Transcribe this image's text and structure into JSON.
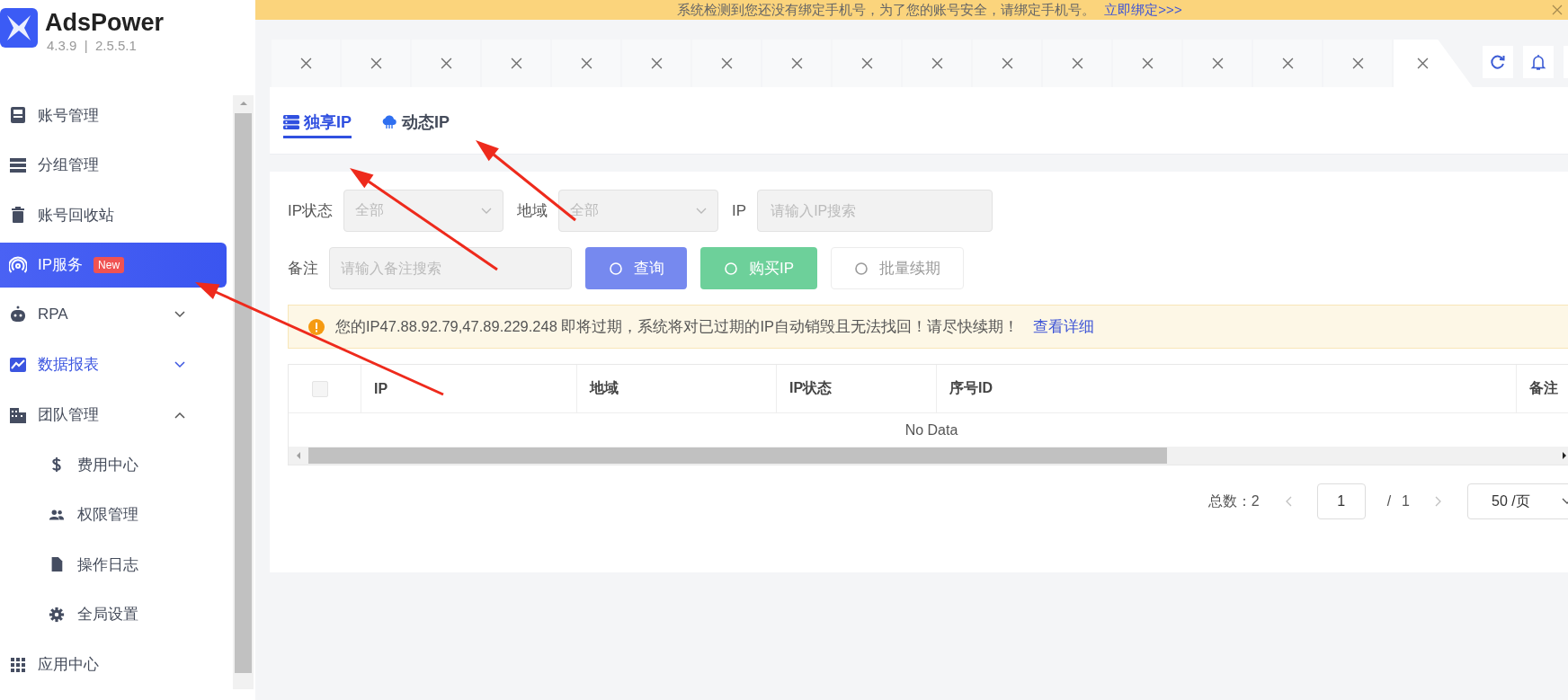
{
  "app": {
    "name": "AdsPower",
    "version": "4.3.9  |  2.5.5.1"
  },
  "sidebar": {
    "items": [
      {
        "label": "账号管理",
        "kind": "link",
        "selected": false,
        "highlighted": false
      },
      {
        "label": "分组管理",
        "kind": "link",
        "selected": false,
        "highlighted": false
      },
      {
        "label": "账号回收站",
        "kind": "link",
        "selected": false,
        "highlighted": false
      },
      {
        "label": "IP服务",
        "kind": "link",
        "selected": true,
        "highlighted": false,
        "badge": "New"
      },
      {
        "label": "RPA",
        "kind": "group",
        "selected": false,
        "highlighted": false,
        "expanded": false
      },
      {
        "label": "数据报表",
        "kind": "group",
        "selected": false,
        "highlighted": true,
        "expanded": false
      },
      {
        "label": "团队管理",
        "kind": "group",
        "selected": false,
        "highlighted": false,
        "expanded": true,
        "children": [
          {
            "label": "费用中心",
            "selected": false
          },
          {
            "label": "权限管理",
            "selected": false
          },
          {
            "label": "操作日志",
            "selected": false
          },
          {
            "label": "全局设置",
            "selected": false
          }
        ]
      },
      {
        "label": "应用中心",
        "kind": "link",
        "selected": false,
        "highlighted": false
      }
    ]
  },
  "notice": {
    "text": "系统检测到您还没有绑定手机号，为了您的账号安全，请绑定手机号。",
    "link": "立即绑定>>>"
  },
  "tabs": [
    {
      "selected": false
    },
    {
      "selected": false
    },
    {
      "selected": false
    },
    {
      "selected": false
    },
    {
      "selected": false
    },
    {
      "selected": false
    },
    {
      "selected": false
    },
    {
      "selected": false
    },
    {
      "selected": false
    },
    {
      "selected": false
    },
    {
      "selected": false
    },
    {
      "selected": false
    },
    {
      "selected": false
    },
    {
      "selected": false
    },
    {
      "selected": false
    },
    {
      "selected": false
    },
    {
      "selected": true
    }
  ],
  "ip_tabs": [
    {
      "label": "独享IP",
      "selected": true
    },
    {
      "label": "动态IP",
      "selected": false
    }
  ],
  "filter_rows": [
    {
      "fields": [
        {
          "label": "IP状态",
          "kind": "select",
          "placeholder": "全部"
        },
        {
          "label": "地域",
          "kind": "select",
          "placeholder": "全部"
        },
        {
          "label": "IP",
          "kind": "input",
          "placeholder": "请输入IP搜索"
        }
      ]
    },
    {
      "fields": [
        {
          "label": "备注",
          "kind": "input",
          "placeholder": "请输入备注搜索"
        }
      ],
      "buttons": [
        {
          "label": "查询",
          "kind": "primary",
          "loading": true,
          "disabled": false
        },
        {
          "label": "购买IP",
          "kind": "success",
          "loading": true,
          "disabled": false
        },
        {
          "label": "批量续期",
          "kind": "default",
          "loading": true,
          "disabled": true
        }
      ]
    }
  ],
  "alert": {
    "text": "您的IP47.88.92.79,47.89.229.248 即将过期，系统将对已过期的IP自动销毁且无法找回！请尽快续期！",
    "link": "查看详细"
  },
  "table": {
    "select_all_checked": false,
    "columns": [
      "IP",
      "地域",
      "IP状态",
      "序号ID",
      "备注"
    ],
    "empty_text": "No Data"
  },
  "pagination": {
    "total": "总数：2",
    "page": "1",
    "separator": "/",
    "page_count": "1",
    "page_size": "50 /页"
  }
}
